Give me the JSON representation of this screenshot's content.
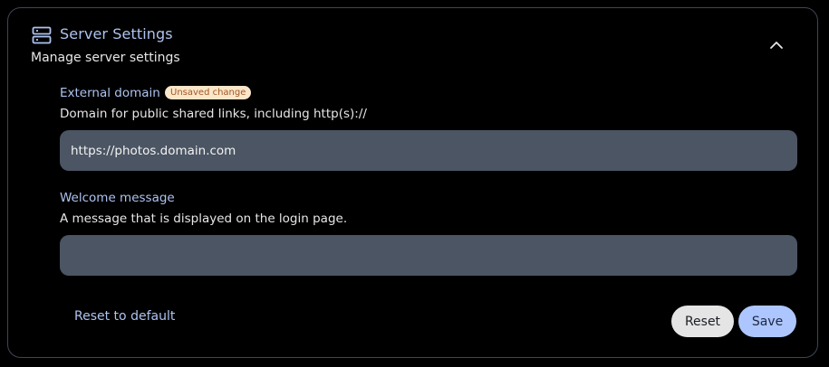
{
  "panel": {
    "title": "Server Settings",
    "subtitle": "Manage server settings",
    "icon": "server-icon",
    "collapse_icon": "chevron-up-icon"
  },
  "fields": {
    "external_domain": {
      "label": "External domain",
      "badge": "Unsaved change",
      "description": "Domain for public shared links, including http(s)://",
      "value": "https://photos.domain.com"
    },
    "welcome_message": {
      "label": "Welcome message",
      "description": "A message that is displayed on the login page.",
      "value": ""
    }
  },
  "actions": {
    "reset_default": "Reset to default",
    "reset": "Reset",
    "save": "Save"
  },
  "colors": {
    "accent": "#aec3f0",
    "badge_bg": "#fbe6c9",
    "badge_text": "#a25826",
    "input_bg": "#4b5563",
    "save_bg": "#adc6ff"
  }
}
